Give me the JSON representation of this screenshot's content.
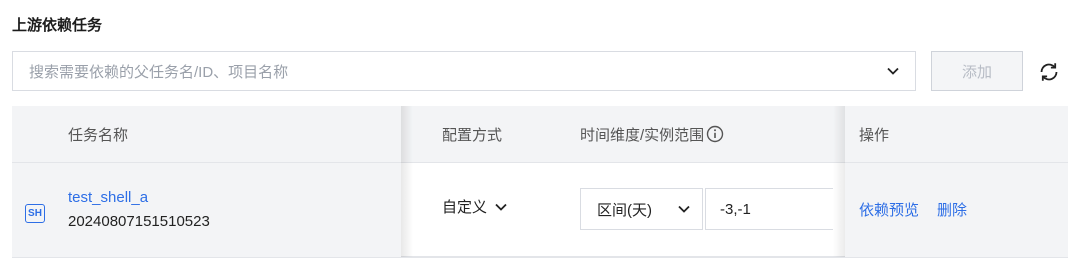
{
  "section": {
    "title": "上游依赖任务"
  },
  "search": {
    "placeholder": "搜索需要依赖的父任务名/ID、项目名称",
    "add_label": "添加"
  },
  "table": {
    "columns": {
      "task_name": "任务名称",
      "config_mode": "配置方式",
      "time_range": "时间维度/实例范围",
      "actions": "操作"
    },
    "rows": [
      {
        "type_badge": "SH",
        "task_name": "test_shell_a",
        "task_id": "20240807151510523",
        "config_mode": "自定义",
        "range_type": "区间(天)",
        "range_value": "-3,-1",
        "action_preview": "依赖预览",
        "action_delete": "删除"
      }
    ]
  },
  "colors": {
    "link": "#2d6ee6",
    "header_bg": "#f3f4f6",
    "border": "#d9dce2"
  },
  "icons": [
    "chevron-down-icon",
    "refresh-icon",
    "info-icon",
    "shell-type-icon"
  ]
}
